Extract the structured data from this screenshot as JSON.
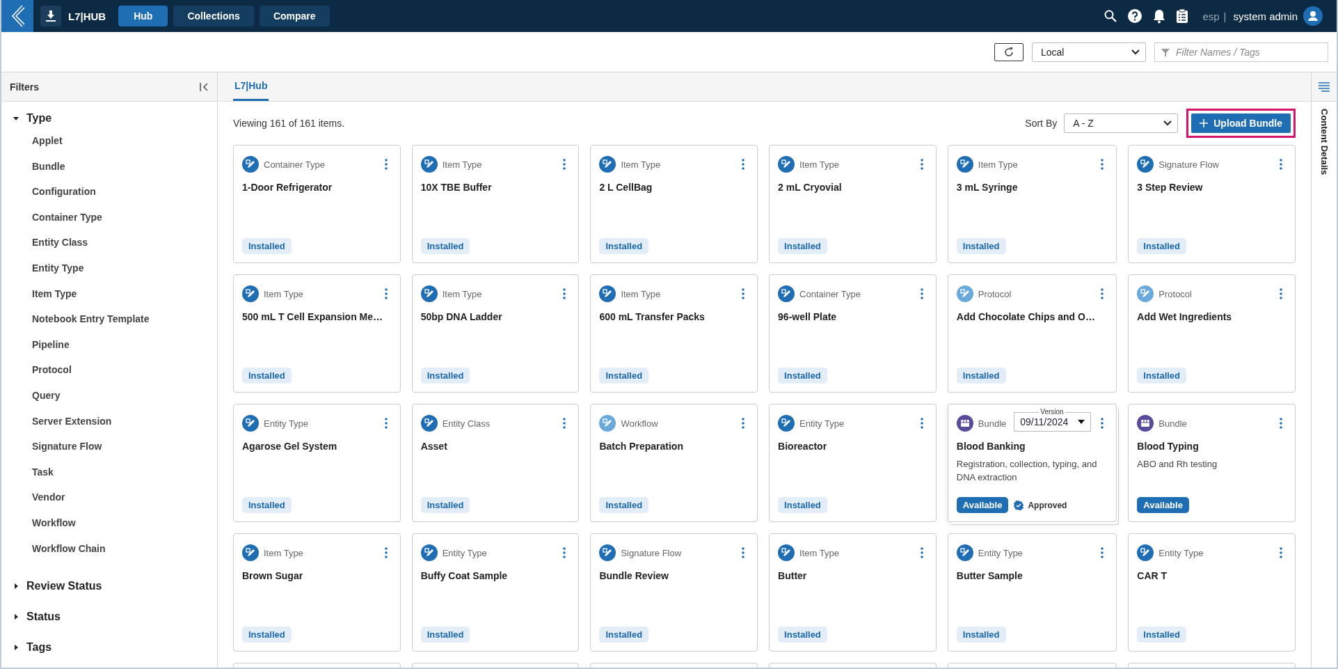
{
  "header": {
    "logo": "L7|HUB",
    "nav": [
      {
        "label": "Hub",
        "selected": true
      },
      {
        "label": "Collections",
        "selected": false
      },
      {
        "label": "Compare",
        "selected": false
      }
    ],
    "workspace": "esp",
    "separator": "|",
    "user": "system admin"
  },
  "toolbar": {
    "source": "Local",
    "filter_placeholder": "Filter Names / Tags"
  },
  "filters": {
    "title": "Filters",
    "groups": [
      {
        "label": "Type",
        "expanded": true,
        "children": [
          {
            "label": "Applet"
          },
          {
            "label": "Bundle"
          },
          {
            "label": "Configuration"
          },
          {
            "label": "Container Type"
          },
          {
            "label": "Entity Class"
          },
          {
            "label": "Entity Type"
          },
          {
            "label": "Item Type"
          },
          {
            "label": "Notebook Entry Template"
          },
          {
            "label": "Pipeline"
          },
          {
            "label": "Protocol"
          },
          {
            "label": "Query"
          },
          {
            "label": "Server Extension"
          },
          {
            "label": "Signature Flow"
          },
          {
            "label": "Task"
          },
          {
            "label": "Vendor"
          },
          {
            "label": "Workflow"
          },
          {
            "label": "Workflow Chain"
          }
        ]
      },
      {
        "label": "Review Status",
        "expanded": false
      },
      {
        "label": "Status",
        "expanded": false
      },
      {
        "label": "Tags",
        "expanded": false
      }
    ]
  },
  "tabs": [
    {
      "label": "L7|Hub",
      "selected": true
    }
  ],
  "content": {
    "count": "Viewing 161 of 161 items.",
    "sort_label": "Sort By",
    "sort_value": "A - Z",
    "upload_button": {
      "label": "Upload Bundle",
      "highlighted": true
    }
  },
  "cards": [
    {
      "kind": "standard",
      "type": "Container Type",
      "color": "#1f6db3",
      "name": "1-Door Refrigerator",
      "status": "Installed",
      "installed": true
    },
    {
      "kind": "standard",
      "type": "Item Type",
      "color": "#1f6db3",
      "name": "10X TBE Buffer",
      "status": "Installed",
      "installed": true
    },
    {
      "kind": "standard",
      "type": "Item Type",
      "color": "#1f6db3",
      "name": "2 L CellBag",
      "status": "Installed",
      "installed": true
    },
    {
      "kind": "standard",
      "type": "Item Type",
      "color": "#1f6db3",
      "name": "2 mL Cryovial",
      "status": "Installed",
      "installed": true
    },
    {
      "kind": "standard",
      "type": "Item Type",
      "color": "#1f6db3",
      "name": "3 mL Syringe",
      "status": "Installed",
      "installed": true
    },
    {
      "kind": "standard",
      "type": "Signature Flow",
      "color": "#1f6db3",
      "name": "3 Step Review",
      "status": "Installed",
      "installed": true
    },
    {
      "kind": "standard",
      "type": "Item Type",
      "color": "#1f6db3",
      "name": "500 mL T Cell Expansion Me…",
      "status": "Installed",
      "installed": true
    },
    {
      "kind": "standard",
      "type": "Item Type",
      "color": "#1f6db3",
      "name": "50bp DNA Ladder",
      "status": "Installed",
      "installed": true
    },
    {
      "kind": "standard",
      "type": "Item Type",
      "color": "#1f6db3",
      "name": "600 mL Transfer Packs",
      "status": "Installed",
      "installed": true
    },
    {
      "kind": "standard",
      "type": "Container Type",
      "color": "#1f6db3",
      "name": "96-well Plate",
      "status": "Installed",
      "installed": true
    },
    {
      "kind": "standard",
      "type": "Protocol",
      "color": "#6aa9dc",
      "name": "Add Chocolate Chips and O…",
      "status": "Installed",
      "installed": true
    },
    {
      "kind": "standard",
      "type": "Protocol",
      "color": "#6aa9dc",
      "name": "Add Wet Ingredients",
      "status": "Installed",
      "installed": true
    },
    {
      "kind": "standard",
      "type": "Entity Type",
      "color": "#1f6db3",
      "name": "Agarose Gel System",
      "status": "Installed",
      "installed": true
    },
    {
      "kind": "standard",
      "type": "Entity Class",
      "color": "#1f6db3",
      "name": "Asset",
      "status": "Installed",
      "installed": true
    },
    {
      "kind": "standard",
      "type": "Workflow",
      "color": "#6aa9dc",
      "name": "Batch Preparation",
      "status": "Installed",
      "installed": true
    },
    {
      "kind": "standard",
      "type": "Entity Type",
      "color": "#1f6db3",
      "name": "Bioreactor",
      "status": "Installed",
      "installed": true
    },
    {
      "kind": "bundle",
      "type": "Bundle",
      "color": "#5a4a9c",
      "name": "Blood Banking",
      "version_label": "Version",
      "version": "09/11/2024",
      "description": "Registration, collection, typing, and DNA extraction",
      "status": "Available",
      "installed": false,
      "approval": "Approved"
    },
    {
      "kind": "bundle",
      "type": "Bundle",
      "color": "#5a4a9c",
      "name": "Blood Typing",
      "description": "ABO and Rh testing",
      "status": "Available",
      "installed": false
    },
    {
      "kind": "standard",
      "type": "Item Type",
      "color": "#1f6db3",
      "name": "Brown Sugar",
      "status": "Installed",
      "installed": true
    },
    {
      "kind": "standard",
      "type": "Entity Type",
      "color": "#1f6db3",
      "name": "Buffy Coat Sample",
      "status": "Installed",
      "installed": true
    },
    {
      "kind": "standard",
      "type": "Signature Flow",
      "color": "#1f6db3",
      "name": "Bundle Review",
      "status": "Installed",
      "installed": true
    },
    {
      "kind": "standard",
      "type": "Item Type",
      "color": "#1f6db3",
      "name": "Butter",
      "status": "Installed",
      "installed": true
    },
    {
      "kind": "standard",
      "type": "Entity Type",
      "color": "#1f6db3",
      "name": "Butter Sample",
      "status": "Installed",
      "installed": true
    },
    {
      "kind": "standard",
      "type": "Entity Type",
      "color": "#1f6db3",
      "name": "CAR T",
      "status": "Installed",
      "installed": true
    }
  ],
  "details_panel": {
    "title": "Content Details"
  }
}
